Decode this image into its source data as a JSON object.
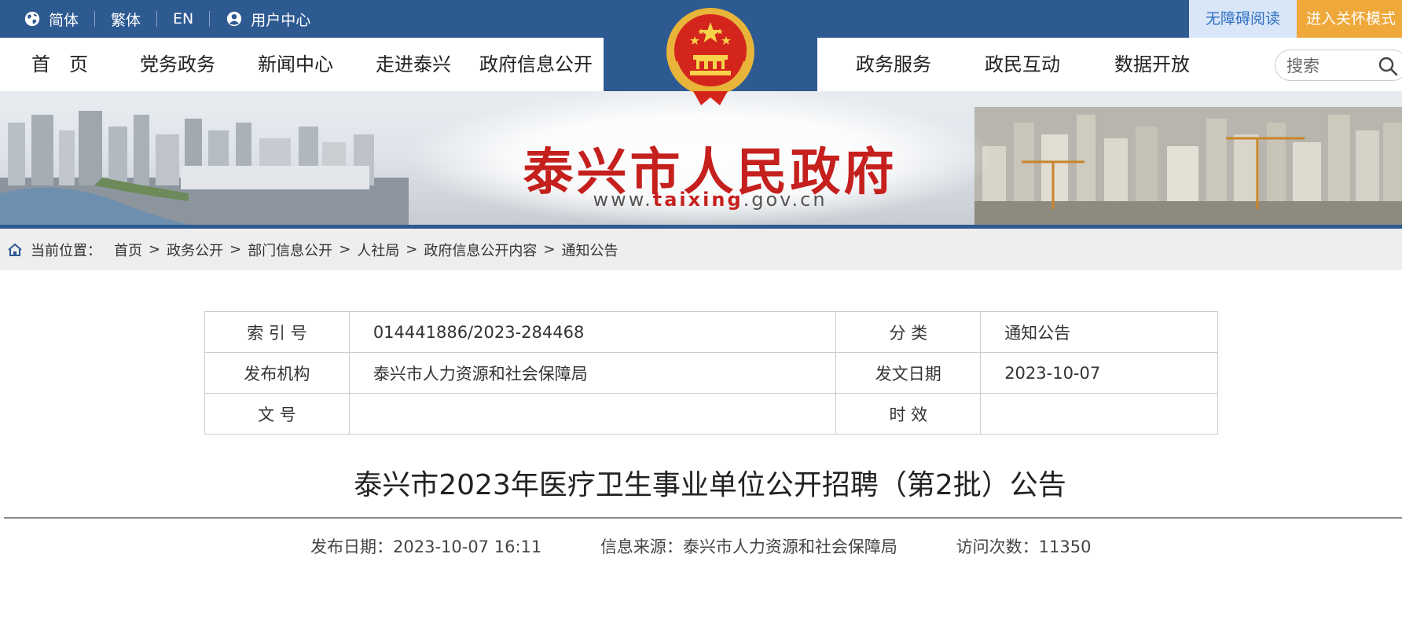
{
  "topbar": {
    "lang_simplified": "简体",
    "lang_traditional": "繁体",
    "lang_en": "EN",
    "user_center": "用户中心",
    "accessible_reading": "无障碍阅读",
    "care_mode": "进入关怀模式"
  },
  "nav": {
    "items": [
      "首　页",
      "党务政务",
      "新闻中心",
      "走进泰兴",
      "政府信息公开",
      "政务服务",
      "政民互动",
      "数据开放"
    ],
    "search_placeholder": "搜索"
  },
  "banner": {
    "title": "泰兴市人民政府",
    "url_prefix": "www.",
    "url_highlight": "taixing",
    "url_suffix": ".gov.cn"
  },
  "breadcrumb": {
    "label": "当前位置：",
    "items": [
      "首页",
      "政务公开",
      "部门信息公开",
      "人社局",
      "政府信息公开内容",
      "通知公告"
    ],
    "separator": ">"
  },
  "meta": {
    "index_label": "索 引 号",
    "index_value": "014441886/2023-284468",
    "category_label": "分 类",
    "category_value": "通知公告",
    "publisher_label": "发布机构",
    "publisher_value": "泰兴市人力资源和社会保障局",
    "date_label": "发文日期",
    "date_value": "2023-10-07",
    "docno_label": "文 号",
    "docno_value": "",
    "validity_label": "时 效",
    "validity_value": ""
  },
  "article": {
    "title": "泰兴市2023年医疗卫生事业单位公开招聘（第2批）公告",
    "publish_date": "发布日期：2023-10-07 16:11",
    "source": "信息来源：泰兴市人力资源和社会保障局",
    "views": "访问次数：11350"
  },
  "colors": {
    "primary_blue": "#2e5a92",
    "banner_red": "#c5201d",
    "care_orange": "#efa83a",
    "accessible_bg": "#d8e6f7"
  }
}
